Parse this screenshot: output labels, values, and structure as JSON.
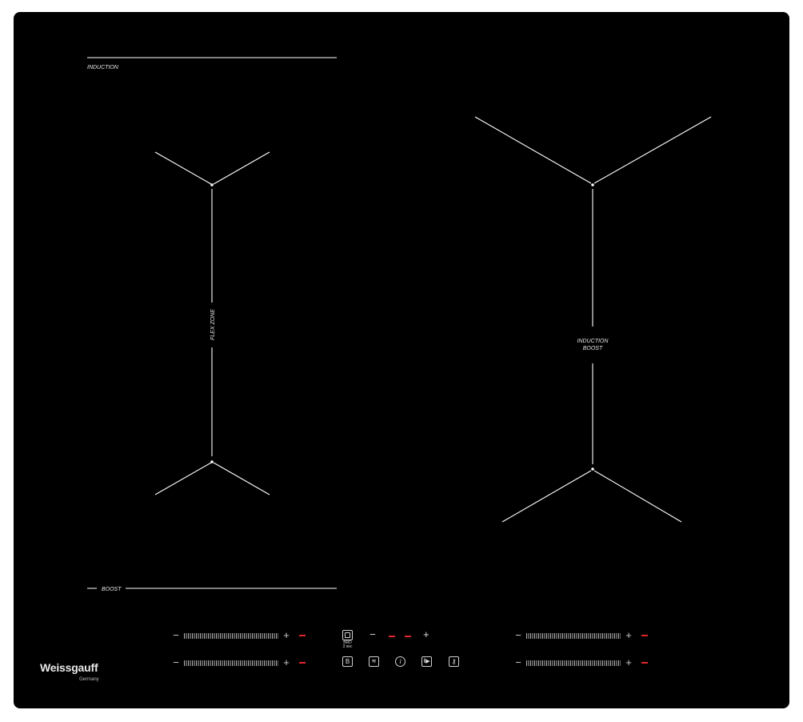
{
  "labels": {
    "top_left": "INDUCTION",
    "boost_left": "BOOST",
    "flex_zone": "FLEX ZONE",
    "right_zone_line1": "INDUCTION",
    "right_zone_line2": "BOOST"
  },
  "controls": {
    "minus": "−",
    "plus": "+",
    "bridge_line1": "BRD",
    "bridge_line2": "3 sec",
    "boost_btn": "B",
    "info_btn": "i"
  },
  "brand": {
    "name": "Weissgauff",
    "subtitle": "Germany"
  },
  "icons": {
    "bridge": "bridge-icon",
    "boost": "boost-icon",
    "keep_warm": "keep-warm-icon",
    "info": "info-icon",
    "pause": "pause-play-icon",
    "lock": "key-lock-icon"
  },
  "colors": {
    "panel": "#000000",
    "lines": "#ffffff",
    "indicator": "#e0252b"
  }
}
